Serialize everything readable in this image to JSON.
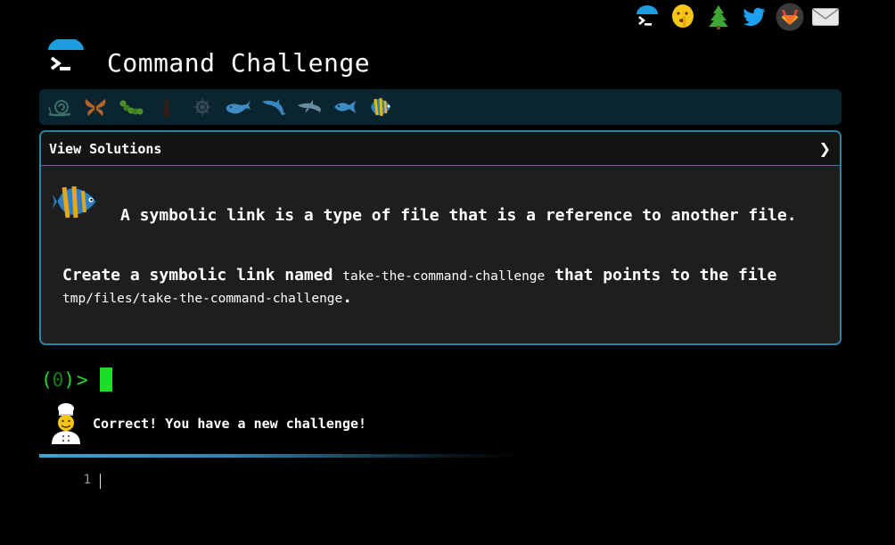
{
  "app": {
    "title": "Command Challenge"
  },
  "top_links": [
    {
      "name": "command-challenge-logo-icon"
    },
    {
      "name": "shushing-face-icon"
    },
    {
      "name": "tree-icon"
    },
    {
      "name": "twitter-icon"
    },
    {
      "name": "gitlab-icon"
    },
    {
      "name": "envelope-icon"
    }
  ],
  "levels": [
    {
      "name": "snail-icon"
    },
    {
      "name": "butterfly-icon"
    },
    {
      "name": "caterpillar-icon"
    },
    {
      "name": "ant-icon"
    },
    {
      "name": "sea-urchin-icon"
    },
    {
      "name": "whale-icon"
    },
    {
      "name": "dolphin-icon"
    },
    {
      "name": "dolphin-icon"
    },
    {
      "name": "fish-icon"
    },
    {
      "name": "tropical-fish-icon"
    }
  ],
  "panel": {
    "header_label": "View Solutions",
    "chevron": "❯",
    "description": "A symbolic link is a type of file that is a reference to another file.",
    "task_prefix": "Create a symbolic link named ",
    "task_link_name": "take-the-command-challenge",
    "task_middle": " that points to the file ",
    "task_target": "tmp/files/take-the-command-challenge",
    "task_suffix": "."
  },
  "prompt": {
    "open": "(",
    "count": "0",
    "close": ")",
    "arrow": ">"
  },
  "message": {
    "text": "Correct! You have a new challenge!"
  },
  "editor": {
    "line_number": "1"
  },
  "colors": {
    "background": "#000000",
    "panel_border": "#2a84a8",
    "panel_bg": "#1e1e1e",
    "level_bar_bg": "#0b2530",
    "prompt_green": "#25d826",
    "cursor_green": "#1fdc29"
  }
}
